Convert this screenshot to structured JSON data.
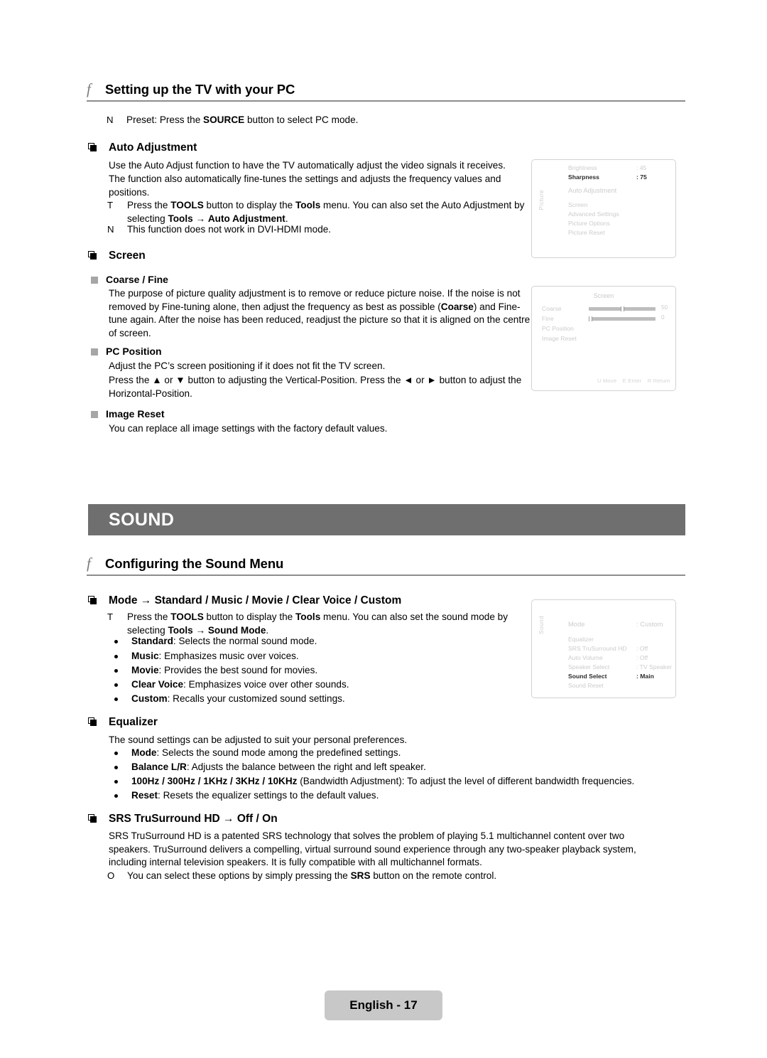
{
  "page": {
    "footer_label": "English - 17"
  },
  "section_pc": {
    "heading_glyph": "f",
    "heading": "Setting up the TV with your PC",
    "preset_note": {
      "marker": "N",
      "text_1": "Preset: Press the ",
      "bold_1": "SOURCE",
      "text_2": " button to select PC mode."
    },
    "auto_adjustment": {
      "heading": "Auto Adjustment",
      "para_1": "Use the Auto Adjust function to have the TV automatically adjust the video signals it receives.",
      "para_2": "The function also automatically fine-tunes the settings and adjusts the frequency values and positions.",
      "note_tools": {
        "marker": "T",
        "t1": "Press the ",
        "b1": "TOOLS",
        "t2": " button to display the ",
        "b2": "Tools",
        "t3": " menu. You can also set the Auto Adjustment by selecting ",
        "b3": "Tools",
        "t4": " → ",
        "b4": "Auto Adjustment",
        "t5": "."
      },
      "note_dvi": {
        "marker": "N",
        "text": "This function does not work in DVI-HDMI mode."
      }
    },
    "screen": {
      "heading": "Screen",
      "coarse_fine": {
        "sub_heading": "Coarse / Fine",
        "t1": "The purpose of picture quality adjustment is to remove or reduce picture noise. If the noise is not removed by Fine-tuning alone, then adjust the frequency as best as possible (",
        "b1": "Coarse",
        "t2": ") and Fine-tune again. After the noise has been reduced, readjust the picture so that it is aligned on the centre of screen."
      },
      "pc_position": {
        "sub_heading": "PC Position",
        "para_1": "Adjust the PC’s screen positioning if it does not fit the TV screen.",
        "para_2": "Press the ▲ or ▼ button to adjusting the Vertical-Position. Press the ◄ or ► button to adjust the Horizontal-Position."
      },
      "image_reset": {
        "sub_heading": "Image Reset",
        "para_1": "You can replace all image settings with the factory default values."
      }
    }
  },
  "banner": {
    "label": "SOUND"
  },
  "section_sound": {
    "heading_glyph": "f",
    "heading": "Configuring the Sound Menu",
    "mode": {
      "heading": "Mode → Standard / Music / Movie / Clear Voice / Custom",
      "note_tools": {
        "marker": "T",
        "t1": "Press the ",
        "b1": "TOOLS",
        "t2": " button to display the ",
        "b2": "Tools",
        "t3": " menu. You can also set the sound mode by selecting ",
        "b3": "Tools",
        "t4": " → ",
        "b4": "Sound Mode",
        "t5": "."
      },
      "items": [
        {
          "term": "Standard",
          "desc": ": Selects the normal sound mode."
        },
        {
          "term": "Music",
          "desc": ": Emphasizes music over voices."
        },
        {
          "term": "Movie",
          "desc": ": Provides the best sound for movies."
        },
        {
          "term": "Clear Voice",
          "desc": ": Emphasizes voice over other sounds."
        },
        {
          "term": "Custom",
          "desc": ": Recalls your customized sound settings."
        }
      ]
    },
    "equalizer": {
      "heading": "Equalizer",
      "para_1": "The sound settings can be adjusted to suit your personal preferences.",
      "items": [
        {
          "term": "Mode",
          "desc": ": Selects the sound mode among the predefined settings."
        },
        {
          "term": "Balance L/R",
          "desc": ": Adjusts the balance between the right and left speaker."
        },
        {
          "term": "100Hz / 300Hz / 1KHz / 3KHz / 10KHz",
          "desc": " (Bandwidth Adjustment): To adjust the level of different bandwidth frequencies."
        },
        {
          "term": "Reset",
          "desc": ": Resets the equalizer settings to the default values."
        }
      ]
    },
    "srs": {
      "heading": "SRS TruSurround HD → Off / On",
      "para_1": "SRS TruSurround HD is a patented SRS technology that solves the problem of playing 5.1 multichannel content over two speakers. TruSurround delivers a compelling, virtual surround sound experience through any two-speaker playback system, including internal television speakers. It is fully compatible with all multichannel formats.",
      "note": {
        "marker": "O",
        "t1": "You can select these options by simply pressing the ",
        "b1": "SRS",
        "t2": " button on the remote control."
      }
    }
  },
  "osd_picture": {
    "vtab": "Picture",
    "rows": [
      {
        "label": "Brightness",
        "value": ": 45",
        "bold": false,
        "arrow": false
      },
      {
        "label": "Sharpness",
        "value": ": 75",
        "bold": true,
        "arrow": false
      },
      {
        "label": "Auto Adjustment",
        "value": "",
        "bold": false,
        "arrow": true
      },
      {
        "label": "Screen",
        "value": "",
        "bold": false,
        "arrow": false
      },
      {
        "label": "Advanced Settings",
        "value": "",
        "bold": false,
        "arrow": false
      },
      {
        "label": "Picture Options",
        "value": "",
        "bold": false,
        "arrow": false
      },
      {
        "label": "Picture Reset",
        "value": "",
        "bold": false,
        "arrow": false
      }
    ]
  },
  "osd_screen": {
    "title": "Screen",
    "rows": [
      {
        "label": "Coarse",
        "slider": true,
        "fill": 50,
        "value": "50"
      },
      {
        "label": "Fine",
        "slider": true,
        "fill": 0,
        "value": "0"
      },
      {
        "label": "PC Position",
        "slider": false,
        "value": ""
      },
      {
        "label": "Image Reset",
        "slider": false,
        "value": ""
      }
    ],
    "hints": [
      "U  Move",
      "E   Enter",
      "R  Return"
    ]
  },
  "osd_sound": {
    "vtab": "Sound",
    "rows": [
      {
        "label": "Mode",
        "value": ": Custom",
        "bold": false,
        "arrow": true
      },
      {
        "label": "Equalizer",
        "value": "",
        "bold": false,
        "arrow": false
      },
      {
        "label": "SRS TruSurround HD",
        "value": ": Off",
        "bold": false,
        "arrow": false
      },
      {
        "label": "Auto Volume",
        "value": ": Off",
        "bold": false,
        "arrow": false
      },
      {
        "label": "Speaker Select",
        "value": ": TV Speaker",
        "bold": false,
        "arrow": false
      },
      {
        "label": "Sound Select",
        "value": ": Main",
        "bold": true,
        "arrow": false
      },
      {
        "label": "Sound Reset",
        "value": "",
        "bold": false,
        "arrow": false
      }
    ]
  }
}
